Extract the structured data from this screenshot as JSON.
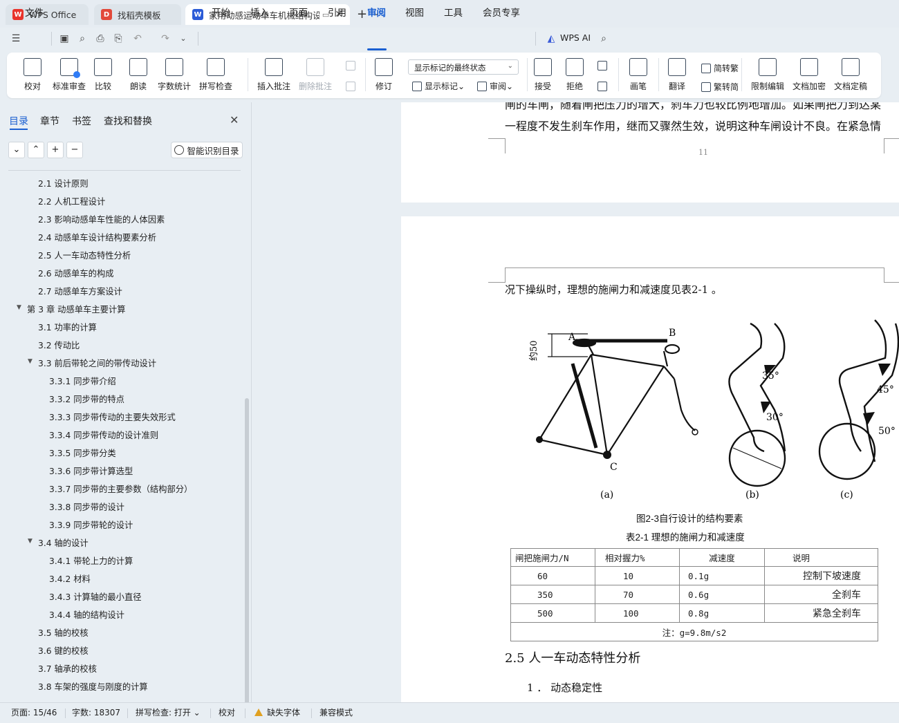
{
  "window": {
    "tabs": [
      {
        "label": "WPS Office",
        "logo": "W"
      },
      {
        "label": "找稻壳模板",
        "logo": "D"
      },
      {
        "label": "家用动感运动单车机械结构设计",
        "logo": "W"
      }
    ]
  },
  "menu": {
    "file": "文件",
    "items": [
      "开始",
      "插入",
      "页面",
      "引用",
      "审阅",
      "视图",
      "工具",
      "会员专享"
    ],
    "active": "审阅",
    "wps_ai": "WPS AI"
  },
  "ribbon": {
    "proofread": "校对",
    "standard_review": "标准审查",
    "compare": "比较",
    "read_aloud": "朗读",
    "word_count": "字数统计",
    "spell_check": "拼写检查",
    "insert_comment": "插入批注",
    "delete_comment": "删除批注",
    "track_changes": "修订",
    "display_mode": "显示标记的最终状态",
    "show_markup": "显示标记",
    "review_pane": "审阅",
    "accept": "接受",
    "reject": "拒绝",
    "pen": "画笔",
    "translate": "翻译",
    "simp_to_trad": "简转繁",
    "trad_to_simp": "繁转简",
    "restrict_edit": "限制编辑",
    "doc_encrypt": "文档加密",
    "doc_finalize": "文档定稿"
  },
  "left_panel": {
    "tabs": [
      "目录",
      "章节",
      "书签",
      "查找和替换"
    ],
    "smart_toc": "智能识别目录",
    "toc": [
      {
        "text": "2.1  设计原则",
        "level": 2
      },
      {
        "text": "2.2  人机工程设计",
        "level": 2
      },
      {
        "text": "2.3  影响动感单车性能的人体因素",
        "level": 2
      },
      {
        "text": "2.4  动感单车设计结构要素分析",
        "level": 2
      },
      {
        "text": "2.5  人一车动态特性分析",
        "level": 2
      },
      {
        "text": "2.6  动感单车的构成",
        "level": 2
      },
      {
        "text": "2.7  动感单车方案设计",
        "level": 2
      },
      {
        "text": "第 3 章   动感单车主要计算",
        "level": 1
      },
      {
        "text": "3.1 功率的计算",
        "level": 2
      },
      {
        "text": "3.2  传动比",
        "level": 2
      },
      {
        "text": "3.3  前后带轮之间的带传动设计",
        "level": 2
      },
      {
        "text": "3.3.1    同步带介绍",
        "level": 3
      },
      {
        "text": "3.3.2    同步带的特点",
        "level": 3
      },
      {
        "text": "3.3.3    同步带传动的主要失效形式",
        "level": 3
      },
      {
        "text": "3.3.4    同步带传动的设计准则",
        "level": 3
      },
      {
        "text": "3.3.5    同步带分类",
        "level": 3
      },
      {
        "text": "3.3.6    同步带计算选型",
        "level": 3
      },
      {
        "text": "3.3.7    同步带的主要参数（结构部分）",
        "level": 3
      },
      {
        "text": "3.3.8    同步带的设计",
        "level": 3
      },
      {
        "text": "3.3.9    同步带轮的设计",
        "level": 3
      },
      {
        "text": "3.4  轴的设计",
        "level": 2
      },
      {
        "text": "3.4.1 带轮上力的计算",
        "level": 3
      },
      {
        "text": "3.4.2 材料",
        "level": 3
      },
      {
        "text": "3.4.3 计算轴的最小直径",
        "level": 3
      },
      {
        "text": "3.4.4 轴的结构设计",
        "level": 3
      },
      {
        "text": "3.5 轴的校核",
        "level": 2
      },
      {
        "text": "3.6 键的校核",
        "level": 2
      },
      {
        "text": "3.7  轴承的校核",
        "level": 2
      },
      {
        "text": "3.8  车架的强度与刚度的计算",
        "level": 2
      }
    ]
  },
  "document": {
    "page11_line1": "闸的车闸，随着闸把压力的增大，刹车力也较比例地增加。如果闸把力到达某",
    "page11_line2": "一程度不发生刹车作用，继而又骤然生效，说明这种车闸设计不良。在紧急情",
    "page_number": "11",
    "page12_line1": "况下操纵时，理想的施闸力和减速度见表2-1 。",
    "figure_labels": {
      "a": "(a)",
      "b": "(b)",
      "c": "(c)",
      "A": "A",
      "B": "B",
      "C": "C",
      "dim": "约50",
      "ang35": "35°",
      "ang30": "30°",
      "ang45": "45°",
      "ang50": "50°"
    },
    "figure_caption": "图2-3自行设计的结构要素",
    "table_caption": "表2-1  理想的施闸力和减速度",
    "table_headers": [
      "闸把施闸力/N",
      "相对握力%",
      "减速度",
      "说明"
    ],
    "table_rows": [
      [
        "60",
        "10",
        "0.1g",
        "控制下坡速度"
      ],
      [
        "350",
        "70",
        "0.6g",
        "全刹车"
      ],
      [
        "500",
        "100",
        "0.8g",
        "紧急全刹车"
      ]
    ],
    "table_note": "注：g=9.8m/s2",
    "section_heading": "2.5  人一车动态特性分析",
    "subsection": "1 ． 动态稳定性"
  },
  "status": {
    "page": "页面: 15/46",
    "words": "字数: 18307",
    "spell": "拼写检查: 打开",
    "proof": "校对",
    "missing_font": "缺失字体",
    "compat": "兼容模式"
  },
  "colors": {
    "accent": "#1a5fd1",
    "wps_red": "#e8342c",
    "docer_red": "#e24a3b",
    "word_blue": "#2b5bd7"
  }
}
